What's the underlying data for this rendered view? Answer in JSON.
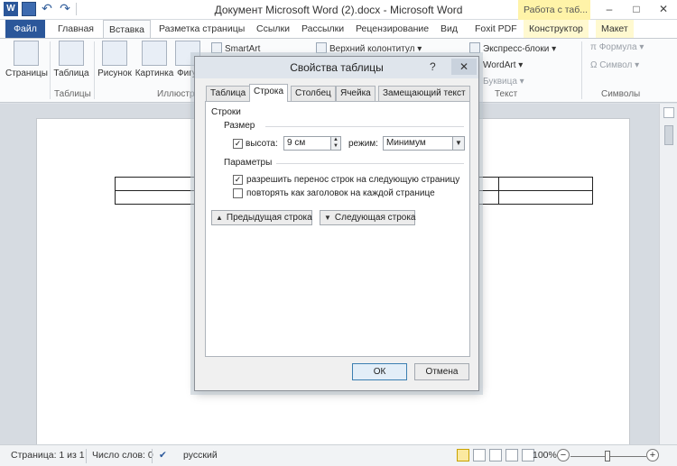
{
  "window": {
    "title": "Документ Microsoft Word (2).docx - Microsoft Word",
    "context_group": "Работа с таб...",
    "minimize": "–",
    "maximize": "□",
    "close": "✕"
  },
  "quick_access": {
    "app_icon": "W",
    "undo": "↶",
    "redo": "↷"
  },
  "ribbon_tabs": [
    "Файл",
    "Главная",
    "Вставка",
    "Разметка страницы",
    "Ссылки",
    "Рассылки",
    "Рецензирование",
    "Вид",
    "Foxit PDF",
    "Конструктор",
    "Макет"
  ],
  "ribbon": {
    "pages_label": "Страницы",
    "table_label": "Таблица",
    "picture_label": "Рисунок",
    "clipart_label": "Картинка",
    "shapes_label": "Фигу",
    "smartart_label": "SmartArt",
    "header_label": "Верхний колонтитул",
    "quickparts_label": "Экспресс-блоки",
    "wordart_label": "WordArt",
    "dropcap_label": "Буквица",
    "formula_label": "Формула",
    "symbol_label": "Символ",
    "group_tables": "Таблицы",
    "group_illustrations": "Иллюстр",
    "group_text": "Текст",
    "group_symbols": "Символы",
    "pi": "π",
    "omega": "Ω"
  },
  "dialog": {
    "title": "Свойства таблицы",
    "help": "?",
    "close": "✕",
    "tabs": [
      "Таблица",
      "Строка",
      "Столбец",
      "Ячейка",
      "Замещающий текст"
    ],
    "active_tab": "Строка",
    "section_rows": "Строки",
    "section_size": "Размер",
    "height_label": "высота:",
    "height_value": "9 см",
    "height_checked": true,
    "mode_label": "режим:",
    "mode_value": "Минимум",
    "section_params": "Параметры",
    "allow_break": "разрешить перенос строк на следующую страницу",
    "allow_break_checked": true,
    "repeat_header": "повторять как заголовок на каждой странице",
    "repeat_header_checked": false,
    "prev_row": "Предыдущая строка",
    "next_row": "Следующая строка",
    "ok": "ОК",
    "cancel": "Отмена",
    "check_mark": "✓"
  },
  "status_bar": {
    "page": "Страница: 1 из 1",
    "words": "Число слов: 0",
    "language": "русский",
    "zoom": "100%",
    "zoom_out": "−",
    "zoom_in": "+"
  }
}
